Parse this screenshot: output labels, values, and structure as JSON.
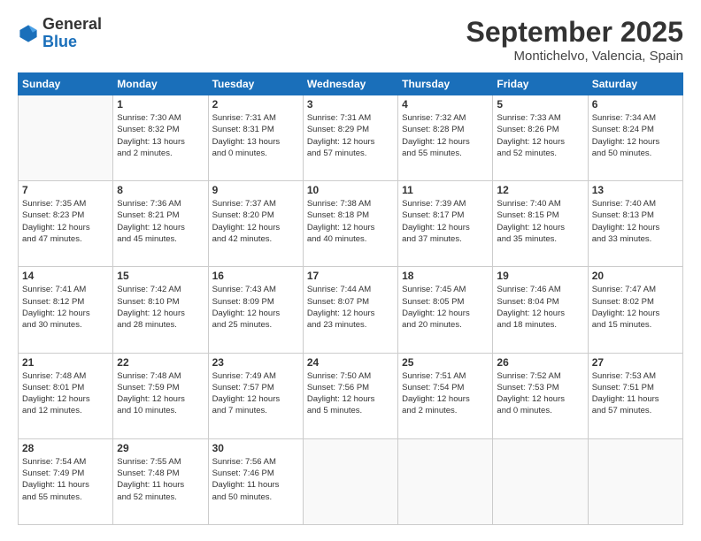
{
  "logo": {
    "general": "General",
    "blue": "Blue"
  },
  "header": {
    "month": "September 2025",
    "location": "Montichelvo, Valencia, Spain"
  },
  "weekdays": [
    "Sunday",
    "Monday",
    "Tuesday",
    "Wednesday",
    "Thursday",
    "Friday",
    "Saturday"
  ],
  "weeks": [
    [
      {
        "day": "",
        "info": ""
      },
      {
        "day": "1",
        "info": "Sunrise: 7:30 AM\nSunset: 8:32 PM\nDaylight: 13 hours\nand 2 minutes."
      },
      {
        "day": "2",
        "info": "Sunrise: 7:31 AM\nSunset: 8:31 PM\nDaylight: 13 hours\nand 0 minutes."
      },
      {
        "day": "3",
        "info": "Sunrise: 7:31 AM\nSunset: 8:29 PM\nDaylight: 12 hours\nand 57 minutes."
      },
      {
        "day": "4",
        "info": "Sunrise: 7:32 AM\nSunset: 8:28 PM\nDaylight: 12 hours\nand 55 minutes."
      },
      {
        "day": "5",
        "info": "Sunrise: 7:33 AM\nSunset: 8:26 PM\nDaylight: 12 hours\nand 52 minutes."
      },
      {
        "day": "6",
        "info": "Sunrise: 7:34 AM\nSunset: 8:24 PM\nDaylight: 12 hours\nand 50 minutes."
      }
    ],
    [
      {
        "day": "7",
        "info": "Sunrise: 7:35 AM\nSunset: 8:23 PM\nDaylight: 12 hours\nand 47 minutes."
      },
      {
        "day": "8",
        "info": "Sunrise: 7:36 AM\nSunset: 8:21 PM\nDaylight: 12 hours\nand 45 minutes."
      },
      {
        "day": "9",
        "info": "Sunrise: 7:37 AM\nSunset: 8:20 PM\nDaylight: 12 hours\nand 42 minutes."
      },
      {
        "day": "10",
        "info": "Sunrise: 7:38 AM\nSunset: 8:18 PM\nDaylight: 12 hours\nand 40 minutes."
      },
      {
        "day": "11",
        "info": "Sunrise: 7:39 AM\nSunset: 8:17 PM\nDaylight: 12 hours\nand 37 minutes."
      },
      {
        "day": "12",
        "info": "Sunrise: 7:40 AM\nSunset: 8:15 PM\nDaylight: 12 hours\nand 35 minutes."
      },
      {
        "day": "13",
        "info": "Sunrise: 7:40 AM\nSunset: 8:13 PM\nDaylight: 12 hours\nand 33 minutes."
      }
    ],
    [
      {
        "day": "14",
        "info": "Sunrise: 7:41 AM\nSunset: 8:12 PM\nDaylight: 12 hours\nand 30 minutes."
      },
      {
        "day": "15",
        "info": "Sunrise: 7:42 AM\nSunset: 8:10 PM\nDaylight: 12 hours\nand 28 minutes."
      },
      {
        "day": "16",
        "info": "Sunrise: 7:43 AM\nSunset: 8:09 PM\nDaylight: 12 hours\nand 25 minutes."
      },
      {
        "day": "17",
        "info": "Sunrise: 7:44 AM\nSunset: 8:07 PM\nDaylight: 12 hours\nand 23 minutes."
      },
      {
        "day": "18",
        "info": "Sunrise: 7:45 AM\nSunset: 8:05 PM\nDaylight: 12 hours\nand 20 minutes."
      },
      {
        "day": "19",
        "info": "Sunrise: 7:46 AM\nSunset: 8:04 PM\nDaylight: 12 hours\nand 18 minutes."
      },
      {
        "day": "20",
        "info": "Sunrise: 7:47 AM\nSunset: 8:02 PM\nDaylight: 12 hours\nand 15 minutes."
      }
    ],
    [
      {
        "day": "21",
        "info": "Sunrise: 7:48 AM\nSunset: 8:01 PM\nDaylight: 12 hours\nand 12 minutes."
      },
      {
        "day": "22",
        "info": "Sunrise: 7:48 AM\nSunset: 7:59 PM\nDaylight: 12 hours\nand 10 minutes."
      },
      {
        "day": "23",
        "info": "Sunrise: 7:49 AM\nSunset: 7:57 PM\nDaylight: 12 hours\nand 7 minutes."
      },
      {
        "day": "24",
        "info": "Sunrise: 7:50 AM\nSunset: 7:56 PM\nDaylight: 12 hours\nand 5 minutes."
      },
      {
        "day": "25",
        "info": "Sunrise: 7:51 AM\nSunset: 7:54 PM\nDaylight: 12 hours\nand 2 minutes."
      },
      {
        "day": "26",
        "info": "Sunrise: 7:52 AM\nSunset: 7:53 PM\nDaylight: 12 hours\nand 0 minutes."
      },
      {
        "day": "27",
        "info": "Sunrise: 7:53 AM\nSunset: 7:51 PM\nDaylight: 11 hours\nand 57 minutes."
      }
    ],
    [
      {
        "day": "28",
        "info": "Sunrise: 7:54 AM\nSunset: 7:49 PM\nDaylight: 11 hours\nand 55 minutes."
      },
      {
        "day": "29",
        "info": "Sunrise: 7:55 AM\nSunset: 7:48 PM\nDaylight: 11 hours\nand 52 minutes."
      },
      {
        "day": "30",
        "info": "Sunrise: 7:56 AM\nSunset: 7:46 PM\nDaylight: 11 hours\nand 50 minutes."
      },
      {
        "day": "",
        "info": ""
      },
      {
        "day": "",
        "info": ""
      },
      {
        "day": "",
        "info": ""
      },
      {
        "day": "",
        "info": ""
      }
    ]
  ]
}
